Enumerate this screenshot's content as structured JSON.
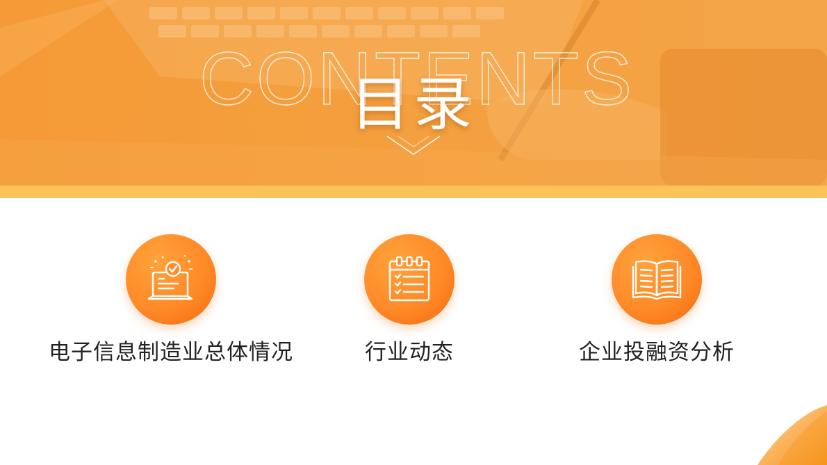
{
  "slide": {
    "watermark_text": "CONTENTS",
    "title": "目录",
    "colors": {
      "banner": "#f7a240",
      "stripe": "#fcc35a",
      "accent": "#ff8a28",
      "text": "#222222"
    },
    "items": [
      {
        "icon": "laptop-check-icon",
        "label": "电子信息制造业总体情况"
      },
      {
        "icon": "calendar-checklist-icon",
        "label": "行业动态"
      },
      {
        "icon": "open-book-icon",
        "label": "企业投融资分析"
      }
    ]
  }
}
